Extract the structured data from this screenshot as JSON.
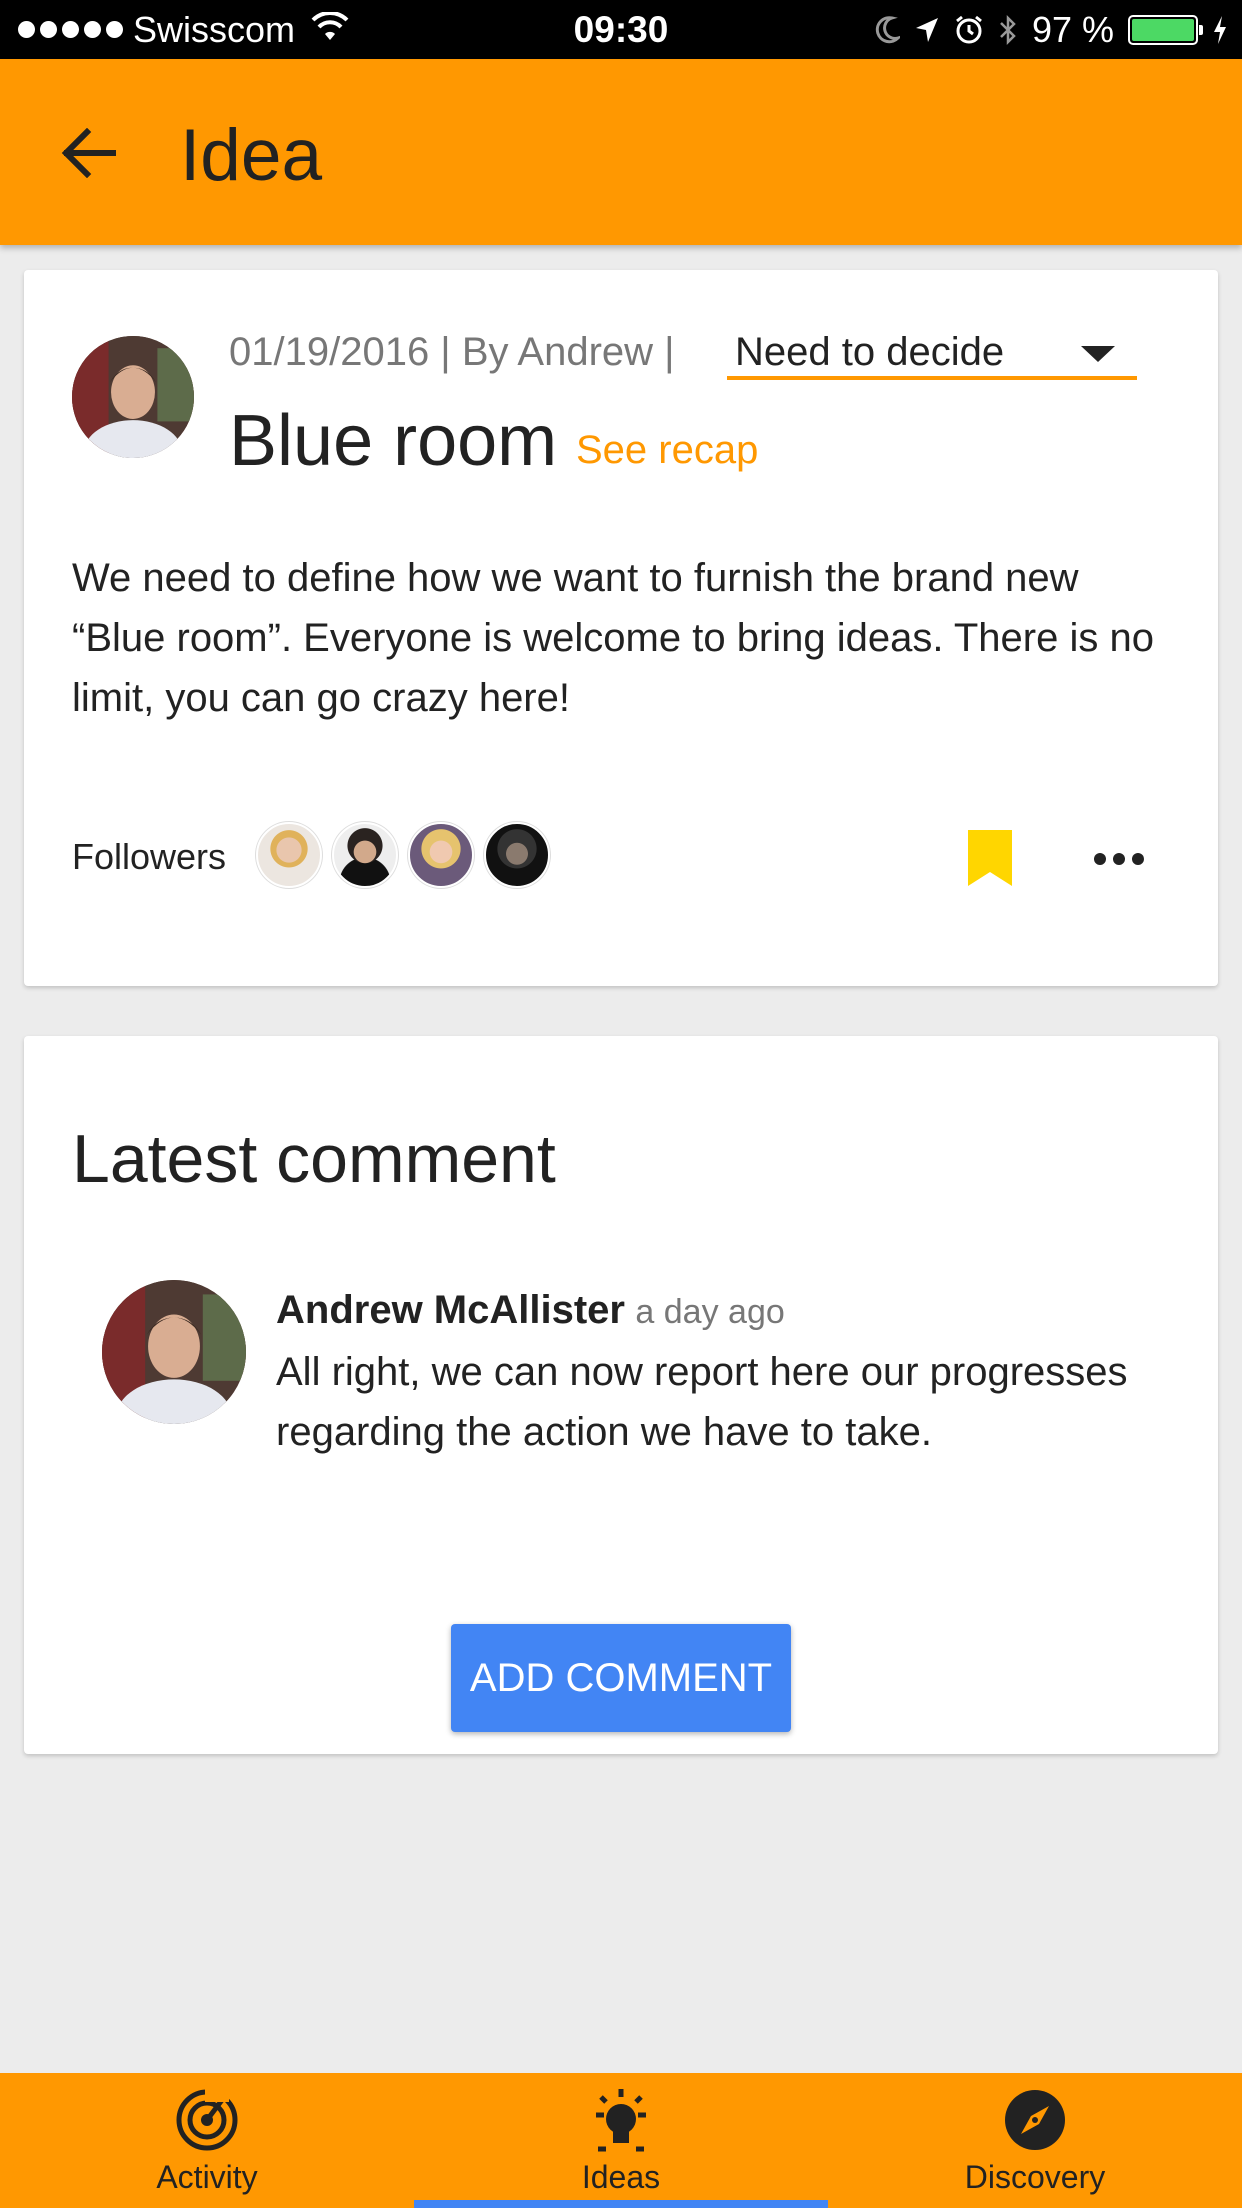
{
  "status_bar": {
    "carrier": "Swisscom",
    "time": "09:30",
    "battery": "97 %",
    "battery_color": "#4cd964"
  },
  "app_bar": {
    "title": "Idea",
    "back_icon": "arrow-back-icon",
    "color": "#ff9801"
  },
  "idea": {
    "meta": "01/19/2016 | By Andrew |",
    "status": "Need to decide",
    "title": "Blue room",
    "see_recap": "See recap",
    "description": "We need to define how we want to furnish the brand new “Blue room”. Everyone is welcome to bring ideas. There is no limit, you can go crazy here!",
    "followers_label": "Followers",
    "follower_count_shown": 4,
    "bookmark_color": "#ffd600"
  },
  "comment_section": {
    "heading": "Latest comment",
    "author": "Andrew McAllister",
    "time": "a day ago",
    "text": "All right, we can now report here our progresses regarding the action we have to take.",
    "add_button": "ADD COMMENT",
    "button_color": "#4285f4"
  },
  "bottom_nav": {
    "items": [
      {
        "label": "Activity",
        "icon": "activity-icon"
      },
      {
        "label": "Ideas",
        "icon": "lightbulb-icon",
        "active": true
      },
      {
        "label": "Discovery",
        "icon": "compass-icon"
      }
    ]
  }
}
